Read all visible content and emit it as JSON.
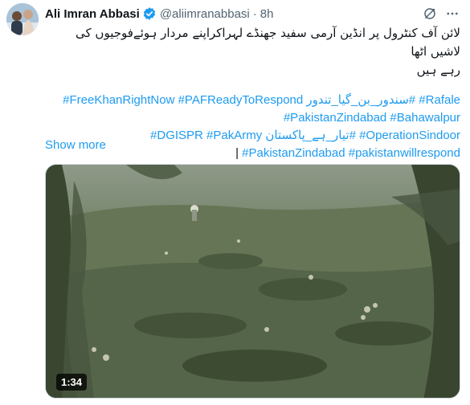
{
  "tweet": {
    "author": {
      "display_name": "Ali Imran Abbasi",
      "handle": "@aliimranabbasi",
      "verified": true,
      "avatar": "avatar-photo"
    },
    "separator": "·",
    "time": "8h",
    "header_icons": [
      "grok-icon",
      "more-icon"
    ],
    "text_line_1": "لائن آف کنٹرول پر انڈین آرمی سفید جھنڈے لہراکراپنے مردار ہوئےفوجیوں کی لاشیں اٹھا",
    "text_line_2": "رہے ہیں",
    "hashtags": {
      "line1_a": "#Rafale",
      "line1_b": "#سندور_بن_گیا_تندور",
      "line1_c": "#FreeKhanRightNow #PAFReadyToRespond",
      "line2": "#PakistanZindabad #Bahawalpur",
      "line3_a": "#OperationSindoor",
      "line3_b": "#تیار_ہے_پاکستان",
      "line3_c": "#DGISPR #PakArmy",
      "line4": "#PakistanZindabad #pakistanwillrespond",
      "line4_bar": "|"
    },
    "show_more": "Show more",
    "media": {
      "type": "video",
      "duration": "1:34"
    },
    "colors": {
      "link": "#1d9bf0",
      "verified": "#1d9bf0",
      "secondary_text": "#536471",
      "text": "#0f1419"
    }
  }
}
